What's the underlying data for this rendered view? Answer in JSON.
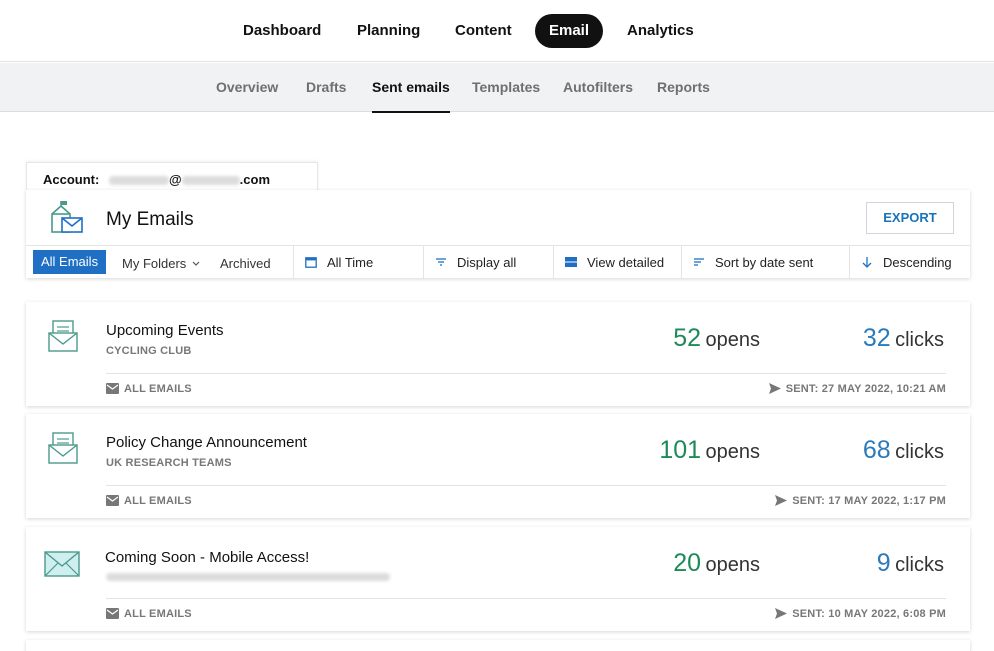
{
  "topnav": {
    "items": [
      "Dashboard",
      "Planning",
      "Content",
      "Email",
      "Analytics"
    ],
    "active": "Email"
  },
  "subnav": {
    "items": [
      "Overview",
      "Drafts",
      "Sent emails",
      "Templates",
      "Autofilters",
      "Reports"
    ],
    "active": "Sent emails"
  },
  "account": {
    "label": "Account:",
    "at": "@",
    "domain_suffix": ".com"
  },
  "header": {
    "title": "My Emails",
    "export_label": "EXPORT"
  },
  "filters": {
    "tabs": [
      "All Emails",
      "My Folders",
      "Archived"
    ],
    "active_tab": "All Emails",
    "time": "All Time",
    "display": "Display all",
    "view": "View detailed",
    "sort": "Sort by date sent",
    "order": "Descending"
  },
  "emails": [
    {
      "subject": "Upcoming Events",
      "audience": "CYCLING CLUB",
      "opens": "52",
      "opens_label": "opens",
      "clicks": "32",
      "clicks_label": "clicks",
      "folder": "ALL EMAILS",
      "sent": "SENT: 27 MAY 2022, 10:21 AM"
    },
    {
      "subject": "Policy Change Announcement",
      "audience": "UK RESEARCH TEAMS",
      "opens": "101",
      "opens_label": "opens",
      "clicks": "68",
      "clicks_label": "clicks",
      "folder": "ALL EMAILS",
      "sent": "SENT: 17 MAY 2022, 1:17 PM"
    },
    {
      "subject": "Coming Soon - Mobile Access!",
      "audience": "",
      "opens": "20",
      "opens_label": "opens",
      "clicks": "9",
      "clicks_label": "clicks",
      "folder": "ALL EMAILS",
      "sent": "SENT: 10 MAY 2022, 6:08 PM"
    }
  ],
  "colors": {
    "accent_blue": "#1f6fc5",
    "opens_green": "#1e8a57",
    "clicks_blue": "#2b7bbb",
    "icon_teal": "#4a9a8a"
  }
}
